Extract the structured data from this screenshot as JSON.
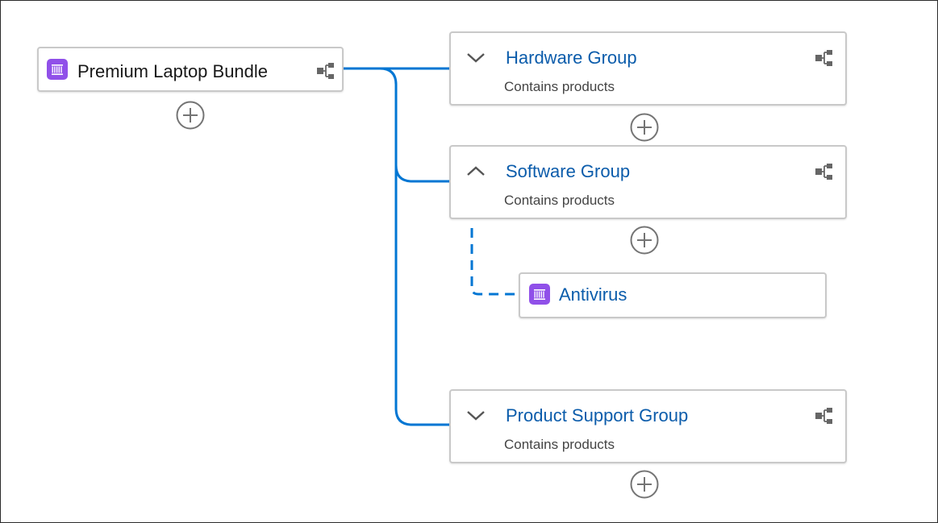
{
  "root": {
    "label": "Premium Laptop Bundle",
    "icon": "product-icon"
  },
  "groups": [
    {
      "title": "Hardware Group",
      "subtitle": "Contains products",
      "expanded": false
    },
    {
      "title": "Software Group",
      "subtitle": "Contains products",
      "expanded": true
    },
    {
      "title": "Product Support Group",
      "subtitle": "Contains products",
      "expanded": false
    }
  ],
  "children": [
    {
      "label": "Antivirus",
      "parent": "Software Group",
      "icon": "product-icon"
    }
  ],
  "colors": {
    "accent": "#0b5cab",
    "connector": "#0176d3",
    "product_icon": "#9050e9",
    "border": "#c9c9c9"
  }
}
